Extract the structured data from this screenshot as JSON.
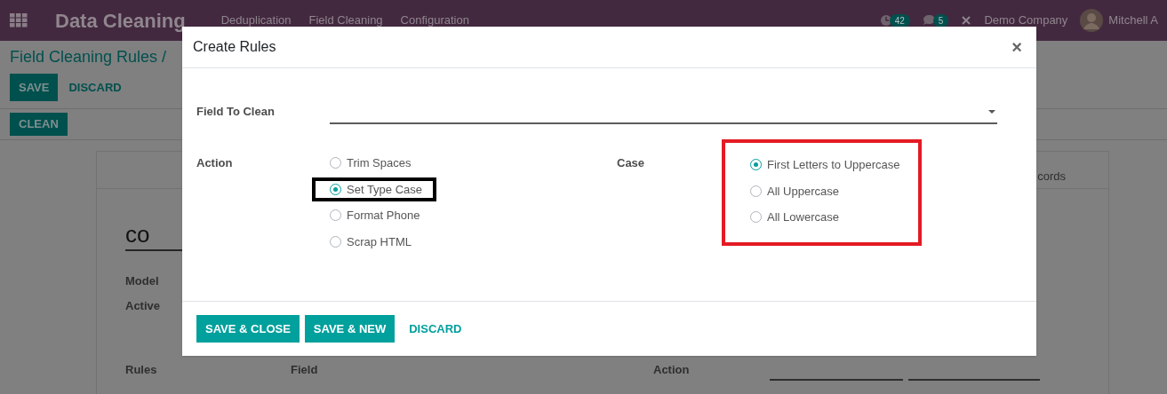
{
  "navbar": {
    "app_title": "Data Cleaning",
    "menu": [
      "Deduplication",
      "Field Cleaning",
      "Configuration"
    ],
    "activity_badge": "42",
    "message_badge": "5",
    "company": "Demo Company",
    "user": "Mitchell A"
  },
  "breadcrumb": "Field Cleaning Rules /",
  "form_buttons": [
    {
      "label": "SAVE",
      "kind": "primary"
    },
    {
      "label": "DISCARD",
      "kind": "link"
    }
  ],
  "clean_button": "CLEAN",
  "record": {
    "name": "co",
    "tab_fragment": "cords",
    "fields": [
      "Model",
      "Active"
    ],
    "rules_label": "Rules",
    "rules_columns": [
      "Field",
      "Action"
    ]
  },
  "dialog": {
    "title": "Create Rules",
    "close": "×",
    "field_to_clean": {
      "label": "Field To Clean"
    },
    "action": {
      "label": "Action",
      "options": [
        {
          "label": "Trim Spaces",
          "selected": false,
          "highlighted": false
        },
        {
          "label": "Set Type Case",
          "selected": true,
          "highlighted": true
        },
        {
          "label": "Format Phone",
          "selected": false,
          "highlighted": false
        },
        {
          "label": "Scrap HTML",
          "selected": false,
          "highlighted": false
        }
      ]
    },
    "case": {
      "label": "Case",
      "highlighted": true,
      "options": [
        {
          "label": "First Letters to Uppercase",
          "selected": true
        },
        {
          "label": "All Uppercase",
          "selected": false
        },
        {
          "label": "All Lowercase",
          "selected": false
        }
      ]
    },
    "buttons": [
      {
        "label": "SAVE & CLOSE",
        "kind": "primary"
      },
      {
        "label": "SAVE & NEW",
        "kind": "primary"
      },
      {
        "label": "DISCARD",
        "kind": "link"
      }
    ]
  }
}
